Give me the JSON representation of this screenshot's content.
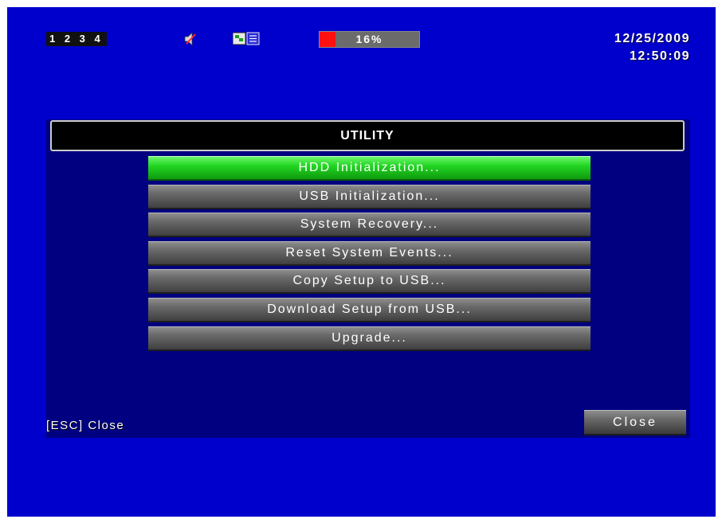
{
  "status_bar": {
    "channels": "1 2 3 4",
    "speaker_icon": "speaker-muted-icon",
    "record_icon": "recording-status-icon",
    "hdd_usage_percent": 16,
    "hdd_usage_label": "16%",
    "hdd_fill_color": "#ff1010",
    "date": "12/25/2009",
    "time": "12:50:09"
  },
  "panel": {
    "title": "UTILITY",
    "menu_items": [
      {
        "label": "HDD Initialization...",
        "selected": true
      },
      {
        "label": "USB Initialization...",
        "selected": false
      },
      {
        "label": "System Recovery...",
        "selected": false
      },
      {
        "label": "Reset System Events...",
        "selected": false
      },
      {
        "label": "Copy Setup to USB...",
        "selected": false
      },
      {
        "label": "Download Setup from USB...",
        "selected": false
      },
      {
        "label": "Upgrade...",
        "selected": false
      }
    ],
    "esc_hint": "[ESC] Close",
    "close_label": "Close"
  },
  "colors": {
    "background": "#0000cc",
    "panel": "#000080",
    "selected_item": "#22d622"
  }
}
